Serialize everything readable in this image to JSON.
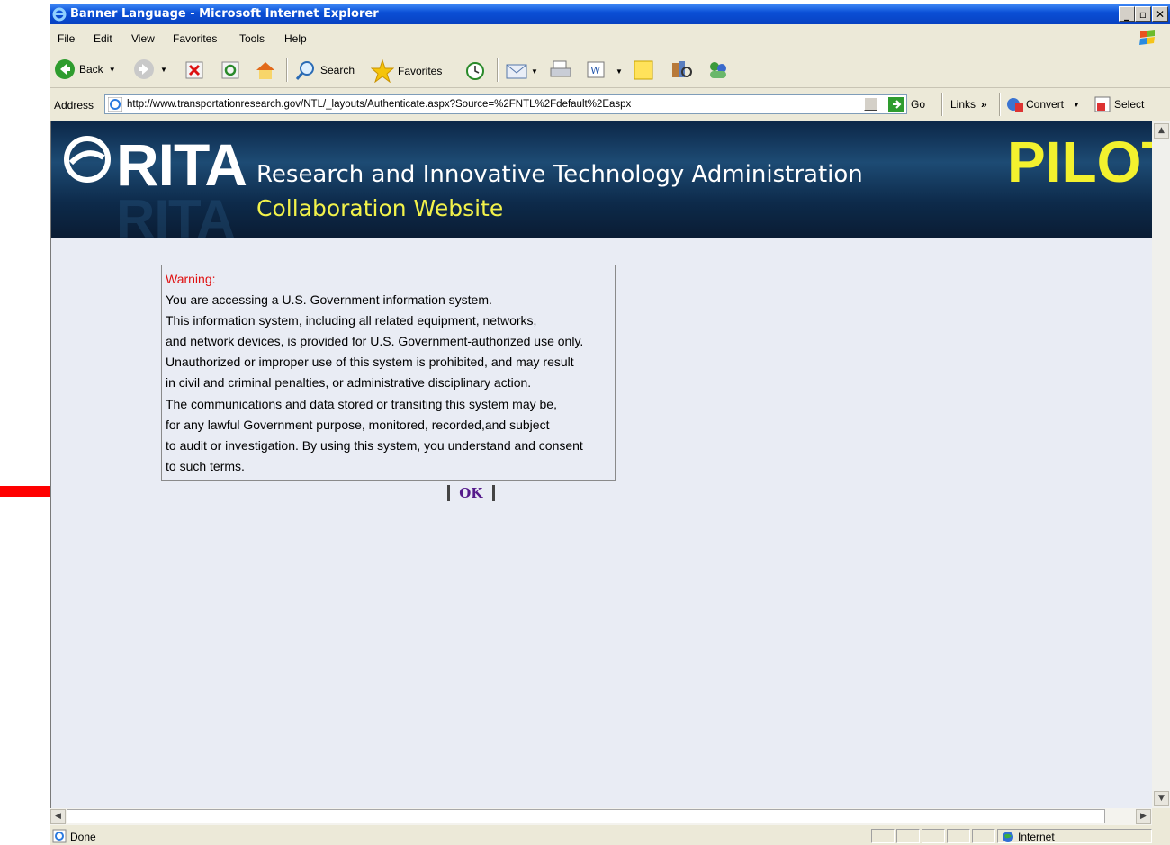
{
  "window": {
    "title": "Banner Language - Microsoft Internet Explorer"
  },
  "menu": [
    "File",
    "Edit",
    "View",
    "Favorites",
    "Tools",
    "Help"
  ],
  "toolbar": {
    "back": "Back",
    "search": "Search",
    "favorites": "Favorites"
  },
  "address": {
    "label": "Address",
    "url": "http://www.transportationresearch.gov/NTL/_layouts/Authenticate.aspx?Source=%2FNTL%2Fdefault%2Easpx",
    "go": "Go",
    "links": "Links",
    "chevron": "»",
    "convert": "Convert",
    "select": "Select"
  },
  "banner": {
    "logo": "RITA",
    "line1": "Research and Innovative Technology Administration",
    "line2": "Collaboration Website",
    "pilot": "PILOT"
  },
  "warning": {
    "heading": "Warning:",
    "lines": [
      "You are accessing a U.S. Government information system.",
      "This information system, including all related equipment, networks,",
      "and network devices, is provided for U.S. Government-authorized use only.",
      "Unauthorized or improper use of this system is prohibited, and may result",
      "in civil and criminal penalties, or administrative disciplinary action.",
      "The communications and data stored or transiting this system may be,",
      "for any lawful Government purpose, monitored, recorded,and subject",
      "to audit or investigation. By using this system, you understand and consent",
      "to such terms."
    ],
    "ok": "OK"
  },
  "status": {
    "text": "Done",
    "zone": "Internet"
  },
  "colors": {
    "annotation_arrow": "#ff0000",
    "warning": "#e01010",
    "banner_yellow": "#f3f12e"
  }
}
